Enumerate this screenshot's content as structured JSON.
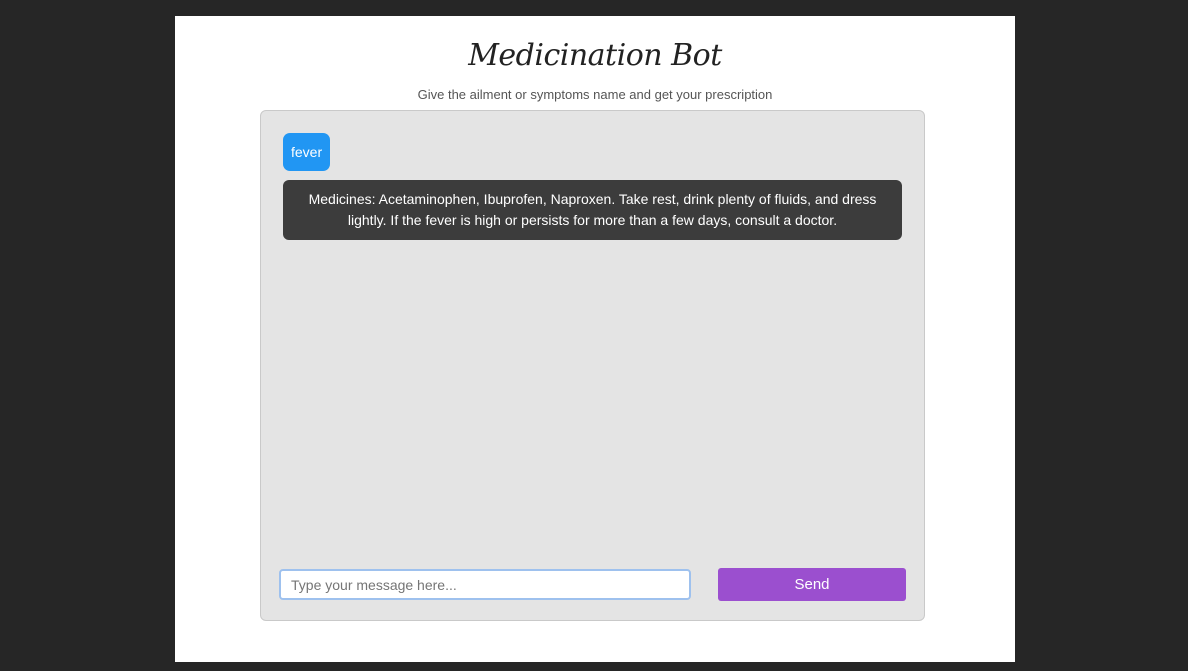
{
  "header": {
    "title": "Medicination Bot",
    "subtitle": "Give the ailment or symptoms name and get your prescription"
  },
  "chat": {
    "messages": [
      {
        "role": "user",
        "text": "fever"
      },
      {
        "role": "bot",
        "text": "Medicines: Acetaminophen, Ibuprofen, Naproxen. Take rest, drink plenty of fluids, and dress lightly. If the fever is high or persists for more than a few days, consult a doctor."
      }
    ]
  },
  "composer": {
    "placeholder": "Type your message here...",
    "value": "",
    "send_label": "Send"
  },
  "colors": {
    "background": "#262626",
    "user_bubble": "#2196f3",
    "bot_bubble": "#3c3c3c",
    "send_button": "#9b4fcf",
    "chat_panel": "#e4e4e4"
  }
}
